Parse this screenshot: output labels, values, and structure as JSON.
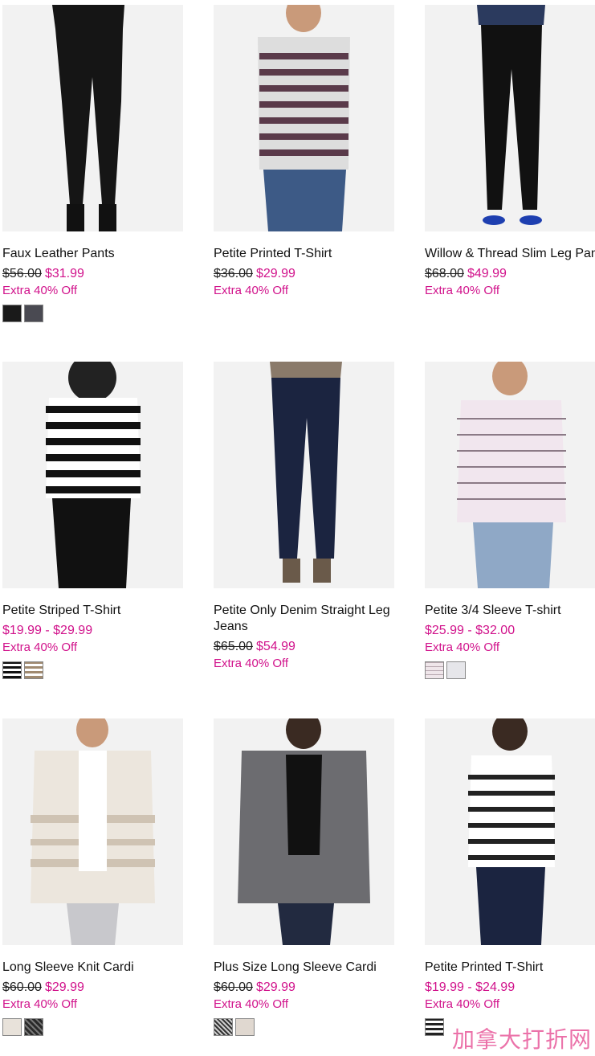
{
  "products": [
    {
      "name": "Faux Leather Pants",
      "original": "$56.00",
      "sale": "$31.99",
      "promo": "Extra 40% Off",
      "swatches": [
        "#1a1a1a",
        "#4a4a52"
      ]
    },
    {
      "name": "Petite Printed T-Shirt",
      "original": "$36.00",
      "sale": "$29.99",
      "promo": "Extra 40% Off",
      "swatches": []
    },
    {
      "name": "Willow & Thread Slim Leg Pant",
      "original": "$68.00",
      "sale": "$49.99",
      "promo": "Extra 40% Off",
      "swatches": []
    },
    {
      "name": "Petite Striped T-Shirt",
      "original": "",
      "sale": "$19.99 - $29.99",
      "promo": "Extra 40% Off",
      "swatches": [
        "#222222",
        "#a08a70"
      ]
    },
    {
      "name": "Petite Only Denim Straight Leg Jeans",
      "original": "$65.00",
      "sale": "$54.99",
      "promo": "Extra 40% Off",
      "swatches": []
    },
    {
      "name": "Petite 3/4 Sleeve T-shirt",
      "original": "",
      "sale": "$25.99 - $32.00",
      "promo": "Extra 40% Off",
      "swatches": [
        "#efe6ea",
        "#e6e6ea"
      ]
    },
    {
      "name": "Long Sleeve Knit Cardi",
      "original": "$60.00",
      "sale": "$29.99",
      "promo": "Extra 40% Off",
      "swatches": [
        "#e8e2da",
        "#2a2a2a"
      ]
    },
    {
      "name": "Plus Size Long Sleeve Cardi",
      "original": "$60.00",
      "sale": "$29.99",
      "promo": "Extra 40% Off",
      "swatches": [
        "#555",
        "#e0d8d0"
      ]
    },
    {
      "name": "Petite Printed T-Shirt",
      "original": "",
      "sale": "$19.99 - $24.99",
      "promo": "Extra 40% Off",
      "swatches": [
        "#222"
      ]
    }
  ],
  "watermark": "加拿大打折网",
  "colors": {
    "sale": "#d1128b",
    "image_bg": "#f3f3f3"
  }
}
